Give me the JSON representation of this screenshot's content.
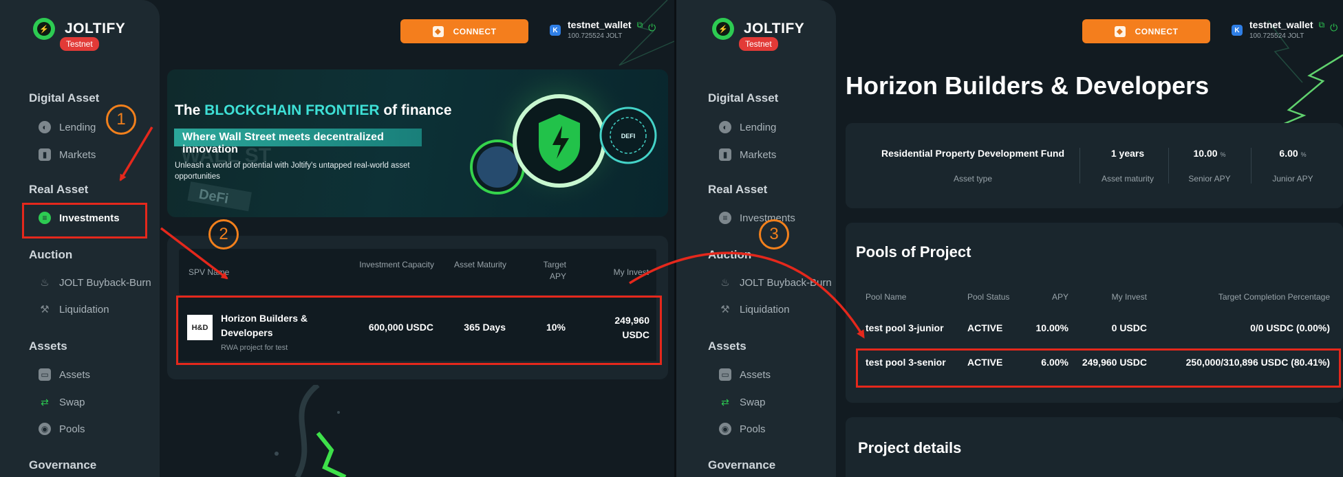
{
  "brand": {
    "name": "JOLTIFY",
    "badge": "Testnet"
  },
  "header": {
    "connect_label": "CONNECT",
    "wallet_name": "testnet_wallet",
    "wallet_balance": "100.725524 JOLT",
    "wallet_icon_letter": "K"
  },
  "sidebar": {
    "sections": [
      {
        "title": "Digital Asset",
        "items": [
          "Lending",
          "Markets"
        ]
      },
      {
        "title": "Real Asset",
        "items": [
          "Investments"
        ]
      },
      {
        "title": "Auction",
        "items": [
          "JOLT Buyback-Burn",
          "Liquidation"
        ]
      },
      {
        "title": "Assets",
        "items": [
          "Assets",
          "Swap",
          "Pools"
        ]
      },
      {
        "title": "Governance",
        "items": []
      }
    ],
    "active_item": "Investments"
  },
  "banner": {
    "title_prefix": "The ",
    "title_highlight": "BLOCKCHAIN FRONTIER",
    "title_suffix": " of finance",
    "subtitle": "Where Wall Street meets decentralized innovation",
    "description": "Unleash a world of potential with Joltify's untapped real-world asset opportunities",
    "badge_text": "DEFI",
    "bg_words": [
      "WALL ST",
      "DeFi"
    ]
  },
  "spv_table": {
    "headers": [
      "SPV Name",
      "Investment Capacity",
      "Asset Maturity",
      "Target APY",
      "My Invest"
    ],
    "rows": [
      {
        "logo": "H&D",
        "name": "Horizon Builders & Developers",
        "subtitle": "RWA project for test",
        "capacity": "600,000 USDC",
        "maturity": "365 Days",
        "apy": "10%",
        "my_invest": "249,960 USDC"
      }
    ]
  },
  "annotations": {
    "step1": "1",
    "step2": "2",
    "step3": "3"
  },
  "project": {
    "title": "Horizon Builders & Developers",
    "stats": [
      {
        "value": "Residential Property Development Fund",
        "unit": "",
        "label": "Asset type"
      },
      {
        "value": "1 years",
        "unit": "",
        "label": "Asset maturity"
      },
      {
        "value": "10.00",
        "unit": "%",
        "label": "Senior APY"
      },
      {
        "value": "6.00",
        "unit": "%",
        "label": "Junior APY"
      }
    ],
    "pools_title": "Pools of Project",
    "pools_headers": [
      "Pool Name",
      "Pool Status",
      "APY",
      "My Invest",
      "Target Completion Percentage"
    ],
    "pools": [
      {
        "name": "test pool 3-junior",
        "status": "ACTIVE",
        "apy": "10.00%",
        "my_invest": "0 USDC",
        "completion": "0/0 USDC (0.00%)"
      },
      {
        "name": "test pool 3-senior",
        "status": "ACTIVE",
        "apy": "6.00%",
        "my_invest": "249,960 USDC",
        "completion": "250,000/310,896 USDC (80.41%)"
      }
    ],
    "details_title": "Project details"
  },
  "colors": {
    "accent_green": "#2dcb52",
    "connect_orange": "#f47e1d",
    "annotation_red": "#e5281c",
    "annotation_orange": "#f2801c",
    "cyan": "#3ee0d6"
  }
}
